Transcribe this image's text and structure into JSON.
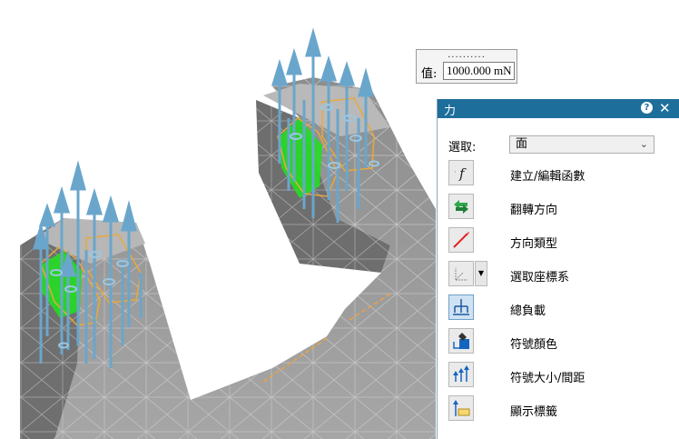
{
  "value_input": {
    "dots": "..........",
    "label": "值:",
    "value": "1000.000 mN"
  },
  "panel": {
    "title": "力",
    "help_icon": "?",
    "close_icon": "✕",
    "selection": {
      "label": "選取:",
      "value": "面"
    },
    "tools": [
      {
        "label": "建立/編輯函數",
        "icon": "function-icon",
        "active": false
      },
      {
        "label": "翻轉方向",
        "icon": "flip-arrows-icon",
        "active": false
      },
      {
        "label": "方向類型",
        "icon": "direction-line-icon",
        "active": false
      },
      {
        "label": "選取座標系",
        "icon": "coordinate-system-icon",
        "active": false
      },
      {
        "label": "總負載",
        "icon": "total-load-icon",
        "active": true
      },
      {
        "label": "符號顏色",
        "icon": "symbol-color-icon",
        "active": false
      },
      {
        "label": "符號大小/間距",
        "icon": "symbol-size-icon",
        "active": false
      },
      {
        "label": "顯示標籤",
        "icon": "show-label-icon",
        "active": false
      }
    ]
  },
  "colors": {
    "title_bar": "#1e6e9c",
    "selected_face": "#22dd22",
    "arrows": "#6aa6cc",
    "hex_outline": "#e8a93c",
    "model_gray": "#8a8a8a"
  }
}
